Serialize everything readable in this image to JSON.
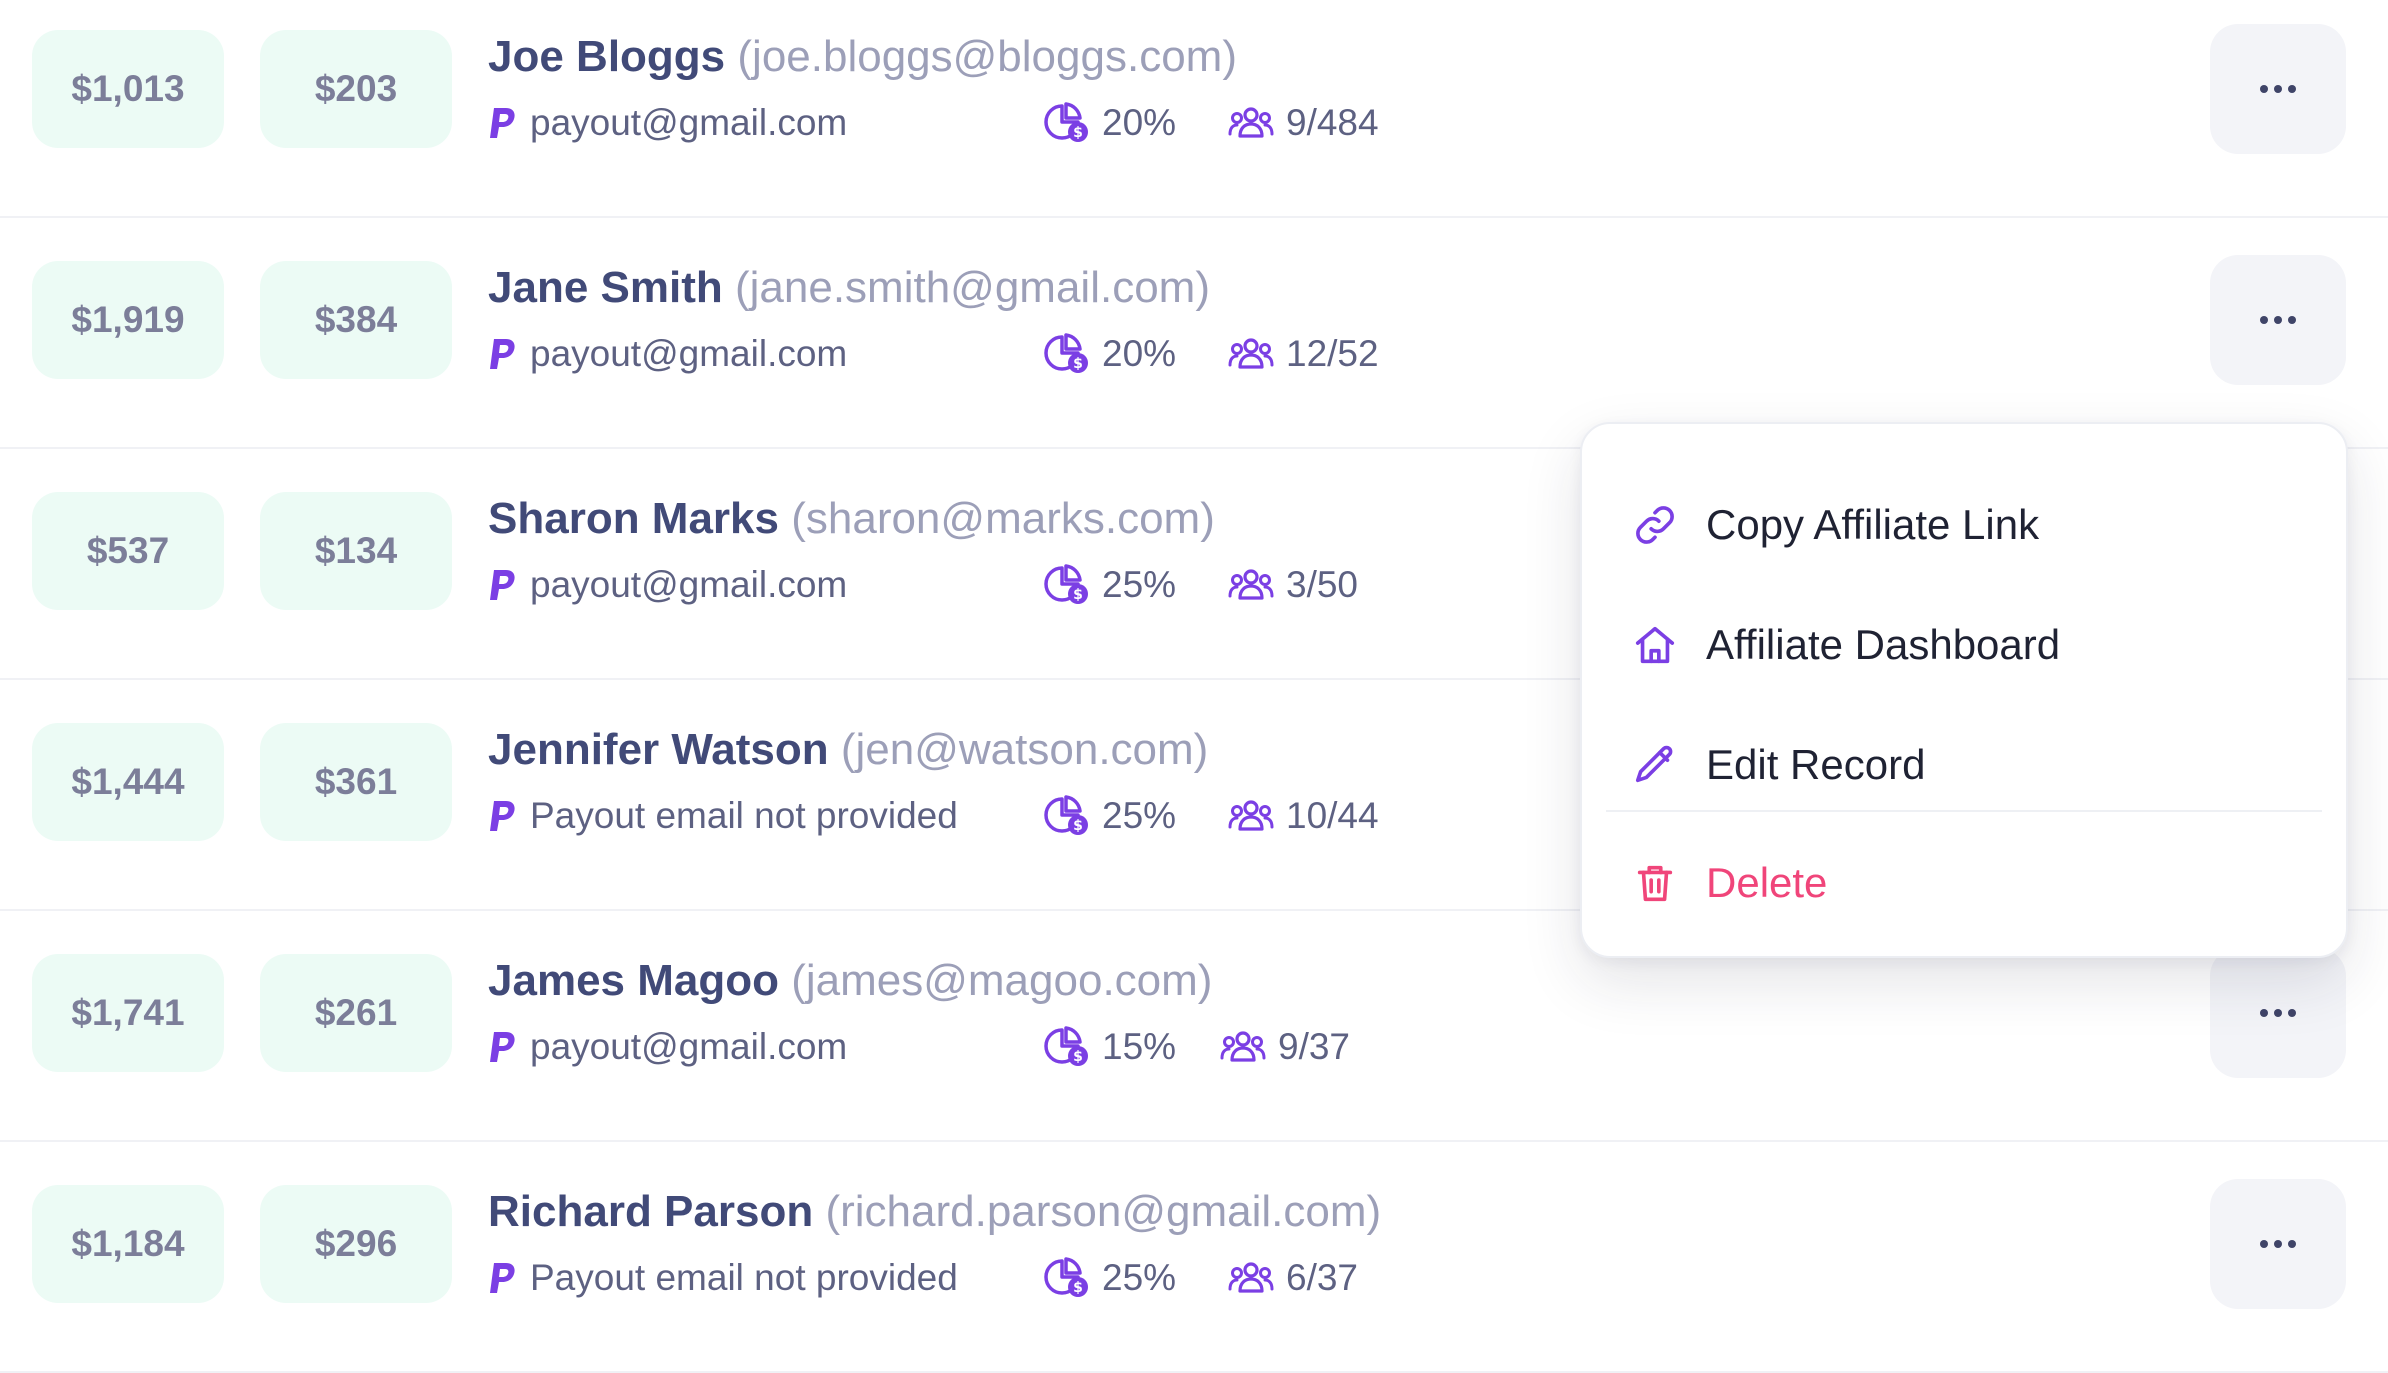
{
  "colors": {
    "pill_bg": "#ecfbf5",
    "name": "#414a78",
    "accent_purple": "#7b3fe4",
    "danger": "#f0457a"
  },
  "rows": [
    {
      "total": "$1,013",
      "commission": "$203",
      "name": "Joe Bloggs",
      "email": "(joe.bloggs@bloggs.com)",
      "payout": "payout@gmail.com",
      "rate": "20%",
      "referrals": "9/484"
    },
    {
      "total": "$1,919",
      "commission": "$384",
      "name": "Jane Smith",
      "email": "(jane.smith@gmail.com)",
      "payout": "payout@gmail.com",
      "rate": "20%",
      "referrals": "12/52"
    },
    {
      "total": "$537",
      "commission": "$134",
      "name": "Sharon Marks",
      "email": "(sharon@marks.com)",
      "payout": "payout@gmail.com",
      "rate": "25%",
      "referrals": "3/50"
    },
    {
      "total": "$1,444",
      "commission": "$361",
      "name": "Jennifer Watson",
      "email": "(jen@watson.com)",
      "payout": "Payout email not provided",
      "rate": "25%",
      "referrals": "10/44"
    },
    {
      "total": "$1,741",
      "commission": "$261",
      "name": "James Magoo",
      "email": "(james@magoo.com)",
      "payout": "payout@gmail.com",
      "rate": "15%",
      "referrals": "9/37"
    },
    {
      "total": "$1,184",
      "commission": "$296",
      "name": "Richard Parson",
      "email": "(richard.parson@gmail.com)",
      "payout": "Payout email not provided",
      "rate": "25%",
      "referrals": "6/37"
    }
  ],
  "menu": {
    "items": [
      {
        "label": "Copy Affiliate Link",
        "icon": "link-icon"
      },
      {
        "label": "Affiliate Dashboard",
        "icon": "home-icon"
      },
      {
        "label": "Edit Record",
        "icon": "pencil-icon"
      },
      {
        "label": "Delete",
        "icon": "trash-icon"
      }
    ]
  }
}
